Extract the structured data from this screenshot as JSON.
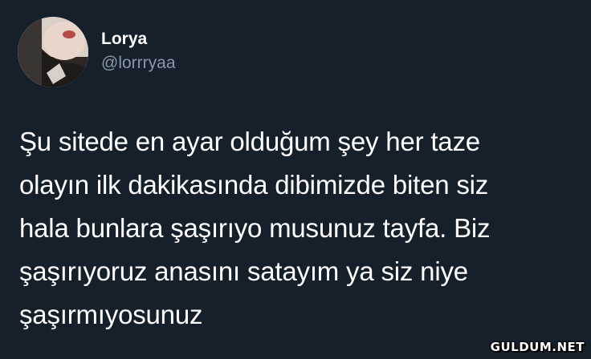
{
  "user": {
    "display_name": "Lorya",
    "handle": "@lorrryaa"
  },
  "tweet": {
    "text": "Şu sitede en ayar olduğum şey her taze\nolayın ilk dakikasında dibimizde biten siz\nhala bunlara şaşırıyo musunuz tayfa. Biz\nşaşırıyoruz anasını satayım ya siz niye\nşaşırmıyosunuz"
  },
  "watermark": {
    "text": "GULDUM.NET"
  },
  "colors": {
    "background": "#15202b",
    "text_primary": "#ffffff",
    "text_secondary": "#8899a6"
  }
}
